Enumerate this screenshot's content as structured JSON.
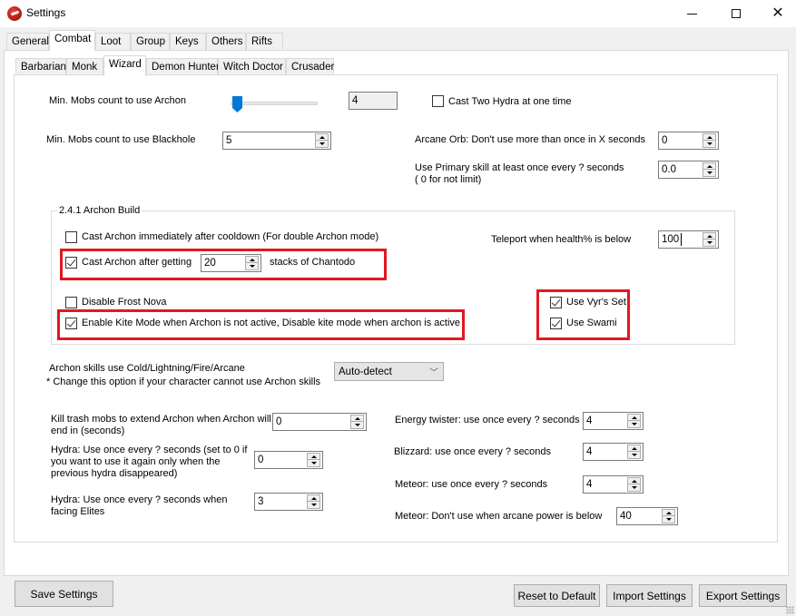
{
  "window": {
    "title": "Settings",
    "minimize_icon": "minimize-icon",
    "maximize_icon": "maximize-icon",
    "close_icon": "close-icon"
  },
  "main_tabs": [
    {
      "label": "General",
      "active": false
    },
    {
      "label": "Combat",
      "active": true
    },
    {
      "label": "Loot",
      "active": false
    },
    {
      "label": "Group",
      "active": false
    },
    {
      "label": "Keys",
      "active": false
    },
    {
      "label": "Others",
      "active": false
    },
    {
      "label": "Rifts",
      "active": false
    }
  ],
  "class_tabs": [
    {
      "label": "Barbarian",
      "active": false
    },
    {
      "label": "Monk",
      "active": false
    },
    {
      "label": "Wizard",
      "active": true
    },
    {
      "label": "Demon Hunter",
      "active": false
    },
    {
      "label": "Witch Doctor",
      "active": false
    },
    {
      "label": "Crusader",
      "active": false
    }
  ],
  "wizard": {
    "archon_min_mobs": {
      "label": "Min. Mobs count to use Archon",
      "value": "4",
      "slider_fraction": 0.0
    },
    "cast_two_hydra": {
      "label": "Cast Two Hydra at one time",
      "checked": false
    },
    "blackhole_min_mobs": {
      "label": "Min. Mobs count to use Blackhole",
      "value": "5"
    },
    "arcane_orb": {
      "label": "Arcane Orb: Don't use more than once in X seconds",
      "value": "0"
    },
    "primary_skill": {
      "label_line1": "Use Primary skill at least once every ? seconds",
      "label_line2": "( 0 for not limit)",
      "value": "0.0"
    },
    "archon_build": {
      "group_title": "2.4.1 Archon Build",
      "cast_immediately": {
        "label": "Cast Archon immediately after cooldown (For double Archon mode)",
        "checked": false
      },
      "cast_after_stacks": {
        "label": "Cast Archon after getting",
        "checked": true,
        "value": "20",
        "suffix": "stacks of Chantodo"
      },
      "teleport_health": {
        "label": "Teleport when health% is below",
        "value": "100"
      },
      "disable_frost_nova": {
        "label": "Disable Frost Nova",
        "checked": false
      },
      "kite_mode": {
        "label": "Enable Kite Mode when Archon is not active, Disable kite mode when archon is active",
        "checked": true
      },
      "use_vyrs_set": {
        "label": "Use Vyr's Set",
        "checked": true
      },
      "use_swami": {
        "label": "Use Swami",
        "checked": true
      }
    },
    "archon_element": {
      "label": "Archon skills use Cold/Lightning/Fire/Arcane",
      "note": "* Change this option if your character cannot use Archon skills",
      "selected": "Auto-detect"
    },
    "kill_trash": {
      "label_line1": "Kill trash mobs to extend Archon when Archon will",
      "label_line2": "end in (seconds)",
      "value": "0"
    },
    "hydra": {
      "label_line1": "Hydra: Use once every ? seconds (set to 0 if",
      "label_line2": "you want to use it again only when the",
      "label_line3": "previous hydra disappeared)",
      "value": "0"
    },
    "hydra_elites": {
      "label_line1": "Hydra: Use once every ? seconds  when",
      "label_line2": "facing Elites",
      "value": "3"
    },
    "energy_twister": {
      "label": "Energy twister: use once every ? seconds",
      "value": "4"
    },
    "blizzard": {
      "label": "Blizzard: use once every ? seconds",
      "value": "4"
    },
    "meteor": {
      "label": "Meteor: use once every ? seconds",
      "value": "4"
    },
    "meteor_arcane": {
      "label": "Meteor: Don't use when arcane power is below",
      "value": "40"
    }
  },
  "footer": {
    "save": "Save Settings",
    "reset": "Reset to Default",
    "import": "Import Settings",
    "export": "Export Settings"
  },
  "colors": {
    "highlight": "#e3171f",
    "slider_thumb": "#0078d7"
  }
}
